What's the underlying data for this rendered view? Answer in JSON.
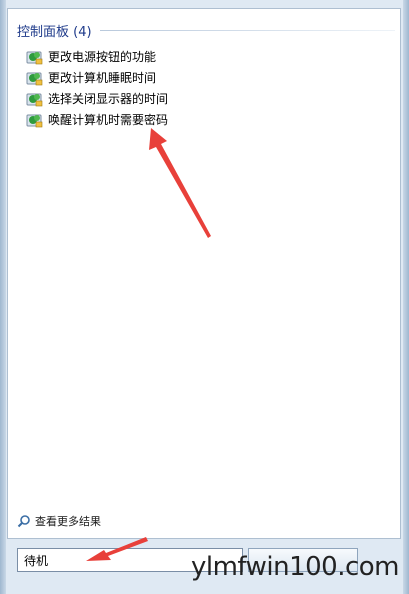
{
  "group": {
    "title": "控制面板 (4)"
  },
  "results": [
    {
      "label": "更改电源按钮的功能",
      "icon": "control-panel-icon"
    },
    {
      "label": "更改计算机睡眠时间",
      "icon": "control-panel-icon"
    },
    {
      "label": "选择关闭显示器的时间",
      "icon": "control-panel-icon"
    },
    {
      "label": "唤醒计算机时需要密码",
      "icon": "control-panel-icon"
    }
  ],
  "see_more": {
    "label": "查看更多结果",
    "icon": "search-icon"
  },
  "search": {
    "value": "待机"
  },
  "watermark": {
    "text": "ylmfwin100.com"
  },
  "colors": {
    "annotation_arrow": "#e8403a",
    "group_title": "#1e3a8a"
  }
}
